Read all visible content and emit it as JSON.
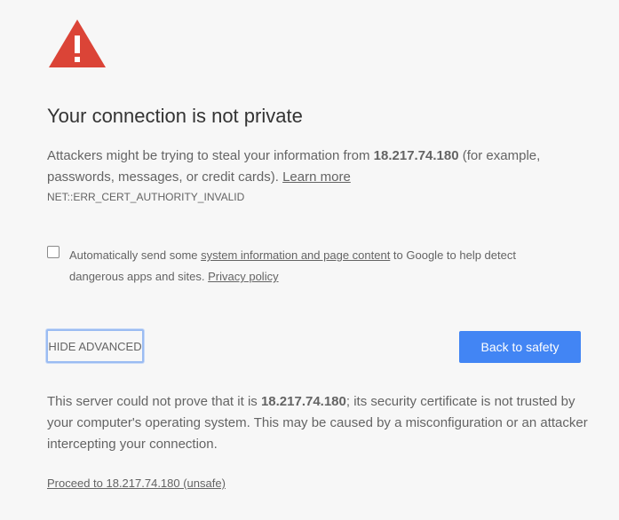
{
  "colors": {
    "background": "#f7f7f7",
    "text": "#646464",
    "heading": "#333333",
    "warning_red": "#db4437",
    "primary_blue": "#4285f4",
    "focus_ring": "#9bbcf2"
  },
  "icon": "warning-triangle-icon",
  "title": "Your connection is not private",
  "message": {
    "prefix": "Attackers might be trying to steal your information from ",
    "host": "18.217.74.180",
    "suffix": " (for example, passwords, messages, or credit cards). ",
    "learn_more": "Learn more"
  },
  "error_code": "NET::ERR_CERT_AUTHORITY_INVALID",
  "checkbox": {
    "checked": false,
    "prefix": "Automatically send some ",
    "link": "system information and page content",
    "middle": " to Google to help detect dangerous apps and sites. ",
    "privacy_link": "Privacy policy"
  },
  "buttons": {
    "hide_advanced": "HIDE ADVANCED",
    "back_to_safety": "Back to safety"
  },
  "details": {
    "prefix": "This server could not prove that it is ",
    "host": "18.217.74.180",
    "suffix": "; its security certificate is not trusted by your computer's operating system. This may be caused by a misconfiguration or an attacker intercepting your connection."
  },
  "proceed_link": "Proceed to 18.217.74.180 (unsafe)"
}
